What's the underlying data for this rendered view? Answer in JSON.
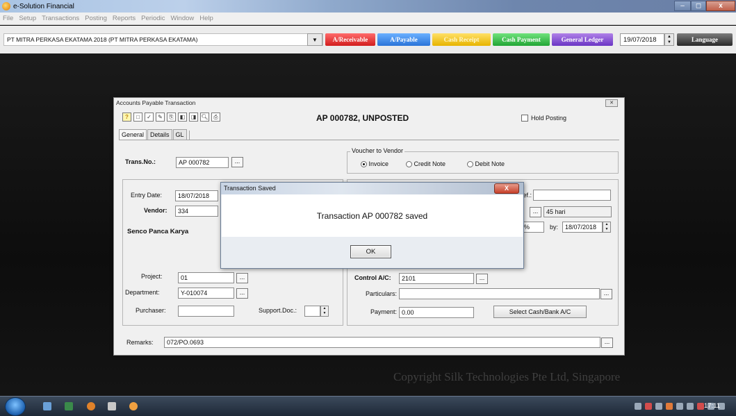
{
  "app": {
    "title": "e-Solution Financial"
  },
  "menu": [
    "File",
    "Setup",
    "Transactions",
    "Posting",
    "Reports",
    "Periodic",
    "Window",
    "Help"
  ],
  "toolbar": {
    "company": "PT MITRA PERKASA EKATAMA 2018 (PT MITRA PERKASA EKATAMA)",
    "buttons": {
      "receivable": "A/Receivable",
      "payable": "A/Payable",
      "cash_receipt": "Cash Receipt",
      "cash_payment": "Cash Payment",
      "general_ledger": "General Ledger"
    },
    "date": "19/07/2018",
    "language": "Language"
  },
  "ap_window": {
    "title": "Accounts Payable Transaction",
    "headline": "AP 000782, UNPOSTED",
    "hold_posting": "Hold Posting",
    "tabs": [
      "General",
      "Details",
      "GL"
    ],
    "trans_no_label": "Trans.No.:",
    "trans_no": "AP 000782",
    "voucher": {
      "title": "Voucher to Vendor",
      "invoice": "Invoice",
      "credit_note": "Credit Note",
      "debit_note": "Debit Note",
      "selected": "Invoice"
    },
    "entry_date_label": "Entry Date:",
    "entry_date": "18/07/2018",
    "vendor_label": "Vendor:",
    "vendor": "334",
    "vendor_name": "Senco Panca Karya",
    "ref_label": "Ref.:",
    "ref": "",
    "terms": "45 hari",
    "percent": "%",
    "by_label": "by:",
    "by_date": "18/07/2018",
    "project_label": "Project:",
    "project": "01",
    "department_label": "Department:",
    "department": "Y-010074",
    "purchaser_label": "Purchaser:",
    "purchaser": "",
    "support_doc_label": "Support.Doc.:",
    "control_ac_label": "Control A/C:",
    "control_ac": "2101",
    "particulars_label": "Particulars:",
    "particulars": "",
    "payment_label": "Payment:",
    "payment": "0.00",
    "select_cash_bank": "Select Cash/Bank A/C",
    "remarks_label": "Remarks:",
    "remarks": "072/PO.0693"
  },
  "dialog": {
    "title": "Transaction Saved",
    "message": "Transaction AP 000782 saved",
    "ok": "OK",
    "close": "X"
  },
  "copyright": "Copyright Silk Technologies Pte Ltd, Singapore",
  "taskbar": {
    "clock": "17:11"
  }
}
